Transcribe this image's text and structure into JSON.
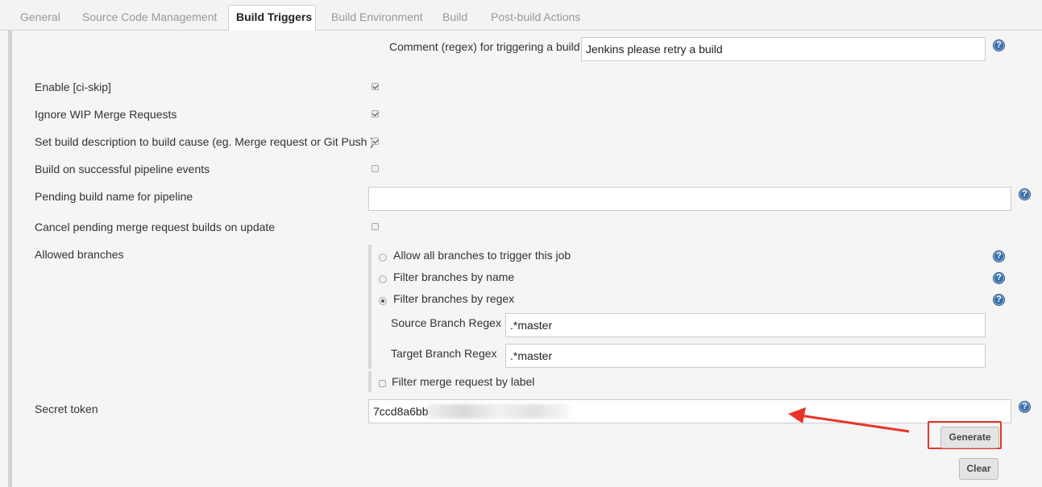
{
  "tabs": [
    {
      "label": "General"
    },
    {
      "label": "Source Code Management"
    },
    {
      "label": "Build Triggers"
    },
    {
      "label": "Build Environment"
    },
    {
      "label": "Build"
    },
    {
      "label": "Post-build Actions"
    }
  ],
  "comment_regex": {
    "label": "Comment (regex) for triggering a build",
    "value": "Jenkins please retry a build"
  },
  "options": {
    "ci_skip": {
      "label": "Enable [ci-skip]",
      "checked": true
    },
    "ignore_wip": {
      "label": "Ignore WIP Merge Requests",
      "checked": true
    },
    "set_description": {
      "label": "Set build description to build cause (eg. Merge request or Git Push )",
      "checked": true
    },
    "pipeline_events": {
      "label": "Build on successful pipeline events",
      "checked": false
    },
    "pending_name": {
      "label": "Pending build name for pipeline",
      "value": ""
    },
    "cancel_pending": {
      "label": "Cancel pending merge request builds on update",
      "checked": false
    }
  },
  "allowed_branches": {
    "label": "Allowed branches",
    "radios": [
      {
        "label": "Allow all branches to trigger this job",
        "selected": false
      },
      {
        "label": "Filter branches by name",
        "selected": false
      },
      {
        "label": "Filter branches by regex",
        "selected": true
      }
    ],
    "source_regex": {
      "label": "Source Branch Regex",
      "value": ".*master"
    },
    "target_regex": {
      "label": "Target Branch Regex",
      "value": ".*master"
    },
    "filter_label": {
      "label": "Filter merge request by label",
      "checked": false
    }
  },
  "secret_token": {
    "label": "Secret token",
    "value": "7ccd8a6bb"
  },
  "buttons": {
    "generate": "Generate",
    "clear": "Clear"
  },
  "help_glyph": "?",
  "colors": {
    "highlight": "#e8352b",
    "help": "#3a6fa8"
  }
}
